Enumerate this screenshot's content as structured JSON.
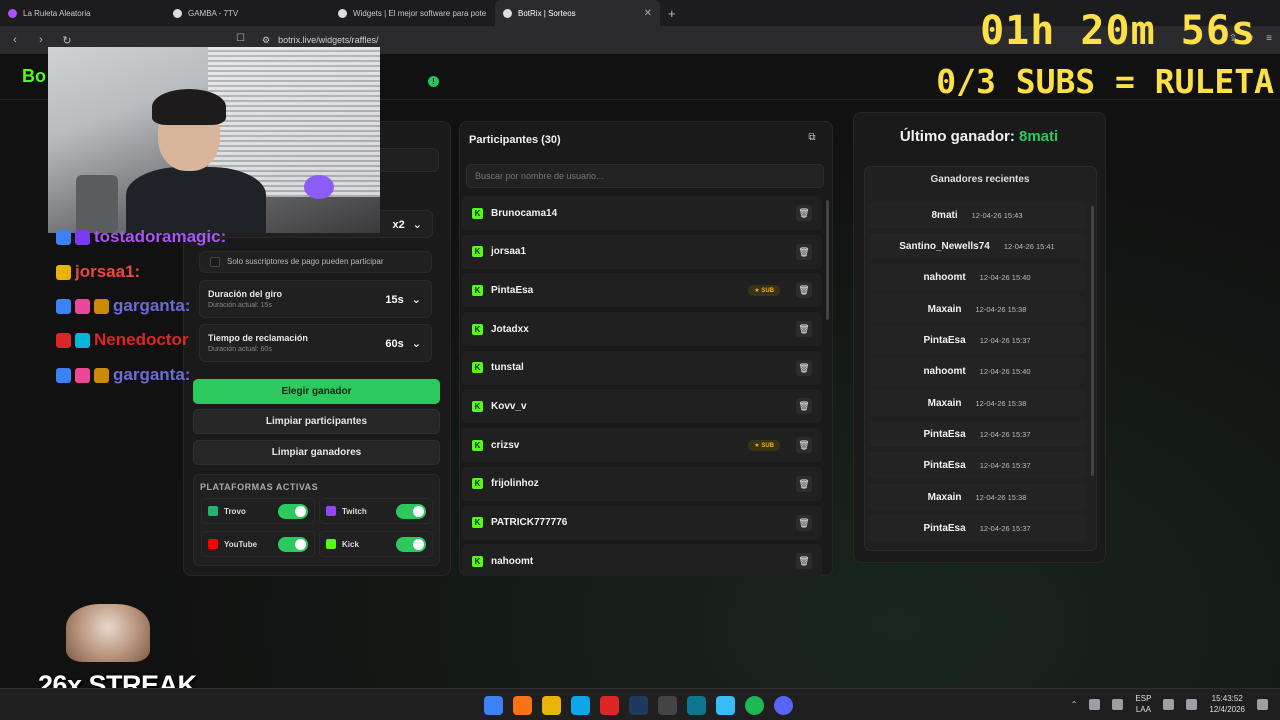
{
  "browser": {
    "tabs": [
      {
        "label": "La Ruleta Aleatoria",
        "color": "#a855f7",
        "active": false
      },
      {
        "label": "GAMBA - 7TV",
        "color": "#dddddd",
        "active": false
      },
      {
        "label": "Widgets | El mejor software para pote",
        "color": "#dddddd",
        "active": false
      },
      {
        "label": "BotRix | Sorteos",
        "color": "#dddddd",
        "active": true
      }
    ],
    "url": "botrix.live/widgets/raffles/"
  },
  "app": {
    "logo": "Bo",
    "config": {
      "multiplier": "x2",
      "subs_only_label": "Solo suscriptores de pago pueden participar",
      "spin_duration_label": "Duración del giro",
      "spin_duration_sub": "Duración actual: 15s",
      "spin_duration_value": "15s",
      "claim_time_label": "Tiempo de reclamación",
      "claim_time_sub": "Duración actual: 60s",
      "claim_time_value": "60s"
    },
    "buttons": {
      "pick_winner": "Elegir ganador",
      "clear_participants": "Limpiar participantes",
      "clear_winners": "Limpiar ganadores"
    },
    "platforms": {
      "title": "PLATAFORMAS ACTIVAS",
      "items": [
        {
          "name": "Trovo",
          "color": "#1fb56f",
          "enabled": true
        },
        {
          "name": "Twitch",
          "color": "#9146ff",
          "enabled": true
        },
        {
          "name": "YouTube",
          "color": "#ff0000",
          "enabled": true
        },
        {
          "name": "Kick",
          "color": "#53fc18",
          "enabled": true
        }
      ]
    },
    "participants": {
      "title": "Participantes (30)",
      "search_placeholder": "Buscar por nombre de usuario...",
      "sub_badge": "SUB",
      "items": [
        {
          "name": "Brunocama14",
          "sub": false
        },
        {
          "name": "jorsaa1",
          "sub": false
        },
        {
          "name": "PintaEsa",
          "sub": true
        },
        {
          "name": "Jotadxx",
          "sub": false
        },
        {
          "name": "tunstal",
          "sub": false
        },
        {
          "name": "Kovv_v",
          "sub": false
        },
        {
          "name": "crizsv",
          "sub": true
        },
        {
          "name": "frijolinhoz",
          "sub": false
        },
        {
          "name": "PATRICK777776",
          "sub": false
        },
        {
          "name": "nahoomt",
          "sub": false
        }
      ]
    },
    "winners": {
      "last_label": "Último ganador:",
      "last_name": "8mati",
      "recent_title": "Ganadores recientes",
      "items": [
        {
          "name": "8mati",
          "time": "12-04-26 15:43"
        },
        {
          "name": "Santino_Newells74",
          "time": "12-04-26 15:41"
        },
        {
          "name": "nahoomt",
          "time": "12-04-26 15:40"
        },
        {
          "name": "Maxain",
          "time": "12-04-26 15:38"
        },
        {
          "name": "PintaEsa",
          "time": "12-04-26 15:37"
        },
        {
          "name": "nahoomt",
          "time": "12-04-26 15:40"
        },
        {
          "name": "Maxain",
          "time": "12-04-26 15:38"
        },
        {
          "name": "PintaEsa",
          "time": "12-04-26 15:37"
        },
        {
          "name": "PintaEsa",
          "time": "12-04-26 15:37"
        },
        {
          "name": "Maxain",
          "time": "12-04-26 15:38"
        },
        {
          "name": "PintaEsa",
          "time": "12-04-26 15:37"
        }
      ]
    }
  },
  "overlay": {
    "timer": "01h 20m 56s",
    "sub_goal": "0/3 SUBS = RULETA",
    "chat": [
      {
        "name": "tostadoramagic:",
        "color": "#a855f7"
      },
      {
        "name": "jorsaa1:",
        "color": "#ef4444"
      },
      {
        "name": "garganta:",
        "color": "#6b6bd6"
      },
      {
        "name": "Nenedoctor",
        "color": "#dc2626"
      },
      {
        "name": "garganta:",
        "color": "#6b6bd6"
      }
    ],
    "streak": "26x STREAK"
  },
  "taskbar": {
    "lang_top": "ESP",
    "lang_bottom": "LAA",
    "time": "15:43:52",
    "date": "12/4/2026"
  }
}
